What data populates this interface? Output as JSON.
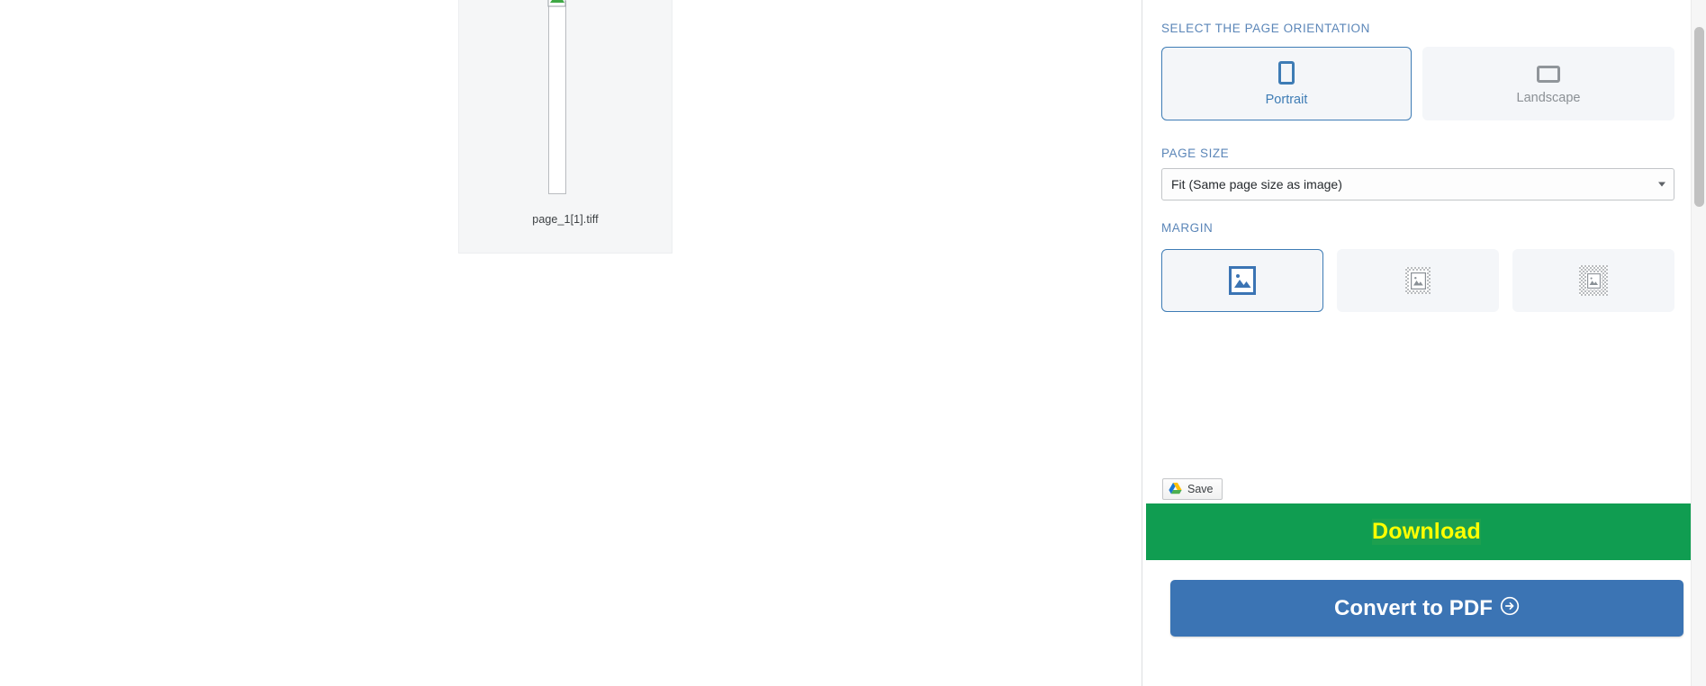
{
  "workspace": {
    "thumbnail": {
      "filename": "page_1[1].tiff",
      "image_state": "broken-image",
      "icon": "broken-image-icon"
    }
  },
  "panel": {
    "orientation": {
      "label": "SELECT THE PAGE ORIENTATION",
      "selected": "Portrait",
      "options": [
        {
          "label": "Portrait",
          "icon": "portrait-page-icon",
          "selected": true
        },
        {
          "label": "Landscape",
          "icon": "landscape-page-icon",
          "selected": false
        }
      ]
    },
    "page_size": {
      "label": "PAGE SIZE",
      "value": "Fit (Same page size as image)",
      "caret": "chevron-down-icon"
    },
    "margin": {
      "label": "MARGIN",
      "selected_index": 0,
      "options": [
        {
          "icon": "image-no-margin-icon",
          "selected": true
        },
        {
          "icon": "image-small-margin-icon",
          "selected": false
        },
        {
          "icon": "image-big-margin-icon",
          "selected": false
        }
      ]
    },
    "save": {
      "label": "Save",
      "icon": "google-drive-icon"
    },
    "download": {
      "label": "Download"
    },
    "convert": {
      "label": "Convert to PDF",
      "icon": "arrow-circle-right-icon"
    }
  },
  "colors": {
    "accent_blue": "#3b74b4",
    "border_blue": "#3e7cb5",
    "label_blue": "#5b86b8",
    "download_green": "#109d51",
    "download_text_yellow": "#ffff00",
    "card_fill": "#f4f6f9",
    "panel_bg": "#ffffff"
  }
}
